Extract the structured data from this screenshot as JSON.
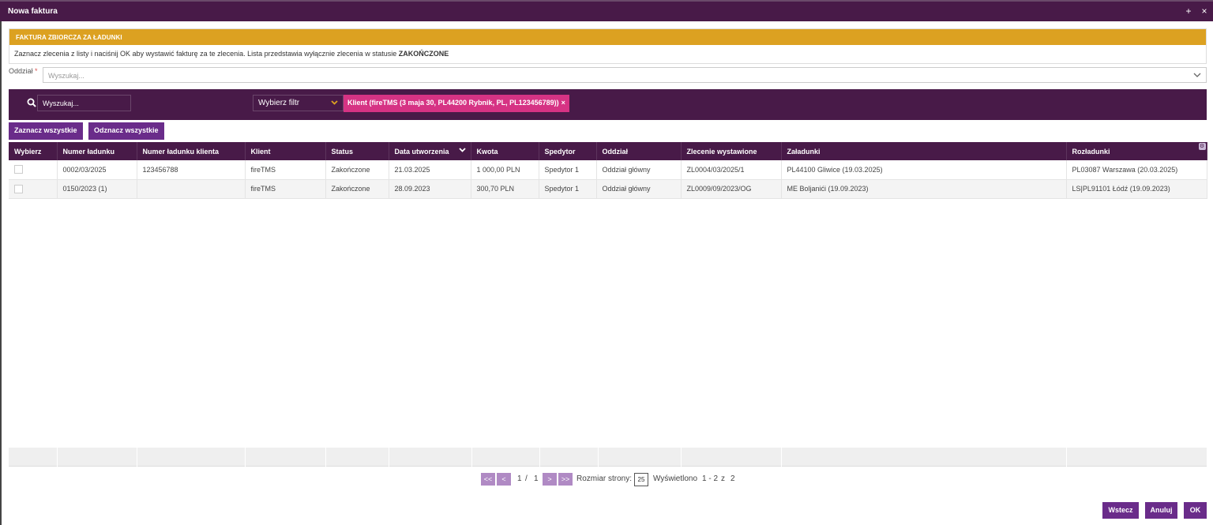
{
  "window": {
    "title": "Nowa faktura",
    "plus_label": "+",
    "close_label": "×"
  },
  "banner": {
    "heading": "FAKTURA ZBIORCZA ZA ŁADUNKI",
    "text": "Zaznacz zlecenia z listy i naciśnij OK aby wystawić fakturę za te zlecenia. Lista przedstawia wyłącznie zlecenia w statusie ",
    "status_word": "ZAKOŃCZONE"
  },
  "oddzial": {
    "label": "Oddział",
    "required_mark": "*",
    "placeholder": "Wyszukaj..."
  },
  "filterbar": {
    "search_placeholder": "Wyszukaj...",
    "filter_select_label": "Wybierz filtr",
    "chip_label": "Klient (fireTMS (3 maja 30, PL44200 Rybnik, PL, PL123456789))",
    "chip_close": "×"
  },
  "buttons": {
    "select_all": "Zaznacz wszystkie",
    "deselect_all": "Odznacz wszystkie"
  },
  "table": {
    "columns": [
      "Wybierz",
      "Numer ładunku",
      "Numer ładunku klienta",
      "Klient",
      "Status",
      "Data utworzenia",
      "Kwota",
      "Spedytor",
      "Oddział",
      "Zlecenie wystawione",
      "Załadunki",
      "Rozładunki"
    ],
    "rows": [
      [
        "",
        "0002/03/2025",
        "123456788",
        "fireTMS",
        "Zakończone",
        "21.03.2025",
        "1 000,00 PLN",
        "Spedytor 1",
        "Oddział główny",
        "ZL0004/03/2025/1",
        "PL44100 Gliwice (19.03.2025)",
        "PL03087 Warszawa (20.03.2025)"
      ],
      [
        "",
        "0150/2023 (1)",
        "",
        "fireTMS",
        "Zakończone",
        "28.09.2023",
        "300,70 PLN",
        "Spedytor 1",
        "Oddział główny",
        "ZL0009/09/2023/OG",
        "ME Boljanići (19.09.2023)",
        "LS|PL91101 Łódź (19.09.2023)"
      ]
    ]
  },
  "pager": {
    "first": "<<",
    "prev": "<",
    "next": ">",
    "last": ">>",
    "page_current": "1",
    "page_sep": "/",
    "page_total": "1",
    "page_size_label": "Rozmiar strony:",
    "page_size": "25",
    "displayed_label": "Wyświetlono",
    "displayed_range": "1 - 2",
    "displayed_of": "z",
    "displayed_total": "2"
  },
  "actions": {
    "back": "Wstecz",
    "cancel": "Anuluj",
    "ok": "OK"
  },
  "colors": {
    "header_bg": "#481a48",
    "banner_bg": "#dca121",
    "chip_bg": "#d63384",
    "button_bg": "#6a2c8a"
  }
}
